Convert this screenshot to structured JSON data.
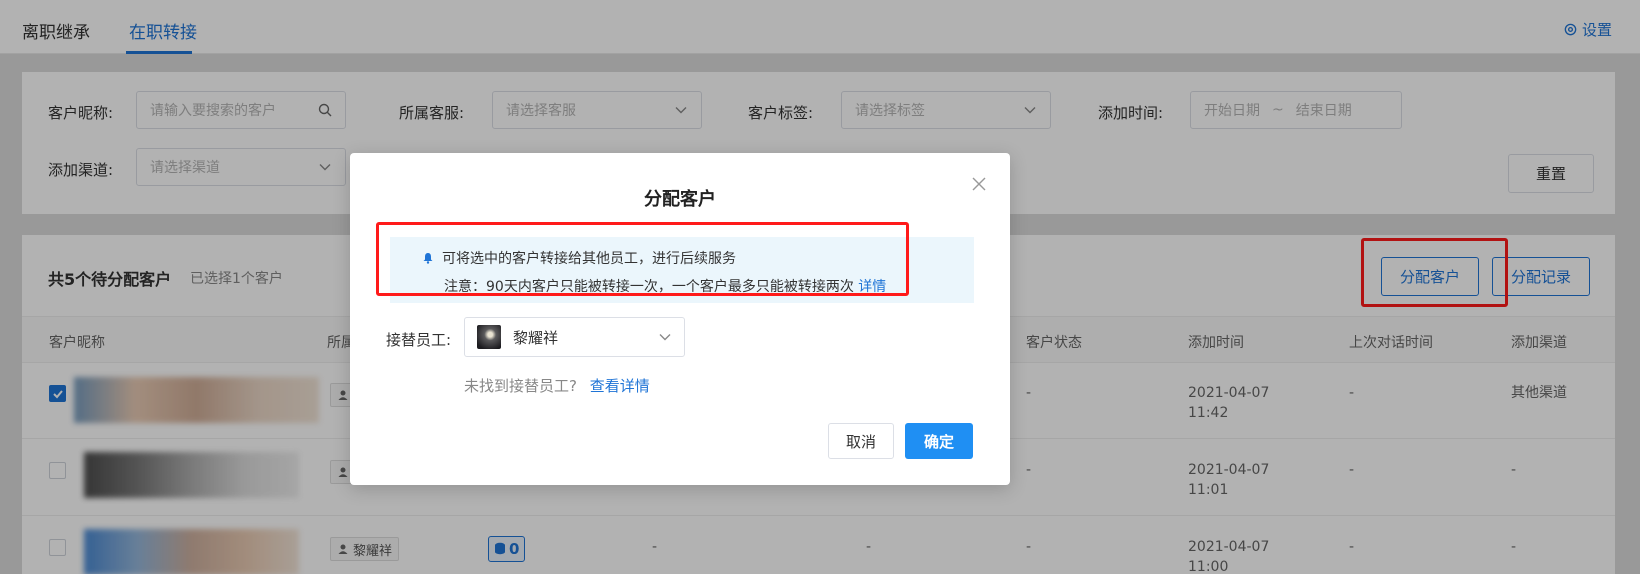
{
  "tabs": [
    {
      "label": "离职继承",
      "active": false
    },
    {
      "label": "在职转接",
      "active": true
    }
  ],
  "settings_label": "设置",
  "filters": {
    "nickname_label": "客户昵称:",
    "nickname_placeholder": "请输入要搜索的客户",
    "service_label": "所属客服:",
    "service_placeholder": "请选择客服",
    "tag_label": "客户标签:",
    "tag_placeholder": "请选择标签",
    "time_label": "添加时间:",
    "start_placeholder": "开始日期",
    "range_sep": "~",
    "end_placeholder": "结束日期",
    "channel_label": "添加渠道:",
    "channel_placeholder": "请选择渠道",
    "reset_label": "重置"
  },
  "list": {
    "count_text": "共5个待分配客户",
    "selected_text": "已选择1个客户",
    "assign_button": "分配客户",
    "record_button": "分配记录",
    "columns": [
      "客户昵称",
      "所属",
      "客户状态",
      "添加时间",
      "上次对话时间",
      "添加渠道"
    ],
    "rows": [
      {
        "checked": true,
        "status": "-",
        "date": "2021-04-07",
        "time": "11:42",
        "last_chat": "-",
        "channel": "其他渠道",
        "owner": "",
        "coins": ""
      },
      {
        "checked": false,
        "status": "-",
        "date": "2021-04-07",
        "time": "11:01",
        "last_chat": "-",
        "channel": "-",
        "owner": "",
        "coins": ""
      },
      {
        "checked": false,
        "status": "-",
        "date": "2021-04-07",
        "time": "11:00",
        "last_chat": "-",
        "channel": "-",
        "owner": "黎耀祥",
        "coins": "0",
        "extra1": "-",
        "extra2": "-"
      }
    ]
  },
  "modal": {
    "title": "分配客户",
    "notice_line1": "可将选中的客户转接给其他员工，进行后续服务",
    "notice_line2": "注意：90天内客户只能被转接一次，一个客户最多只能被转接两次",
    "notice_link": "详情",
    "receiver_label": "接替员工:",
    "receiver_value": "黎耀祥",
    "help_text": "未找到接替员工?",
    "help_link": "查看详情",
    "cancel_label": "取消",
    "ok_label": "确定"
  },
  "colors": {
    "accent": "#1f74d6",
    "primary_button": "#1f8ff3",
    "highlight_box": "#ff1a1a"
  }
}
